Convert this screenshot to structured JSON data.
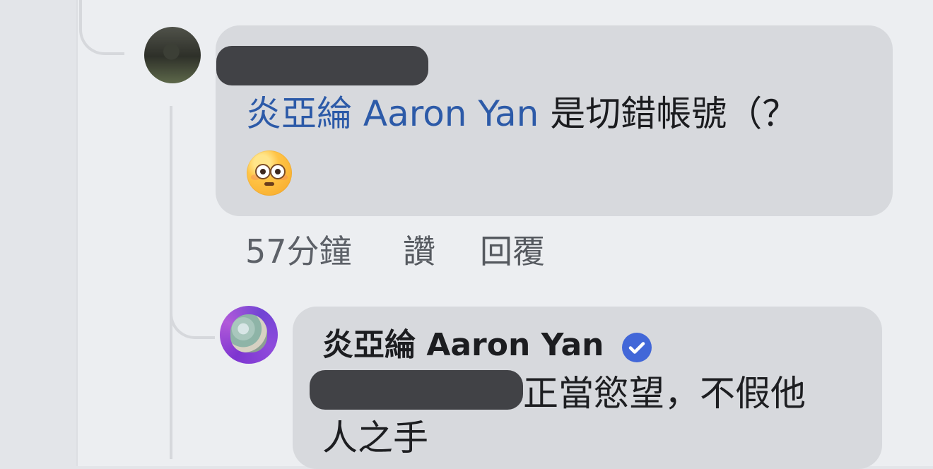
{
  "comment": {
    "mention": "炎亞綸 Aaron Yan",
    "text": "是切錯帳號（？",
    "time": "57分鐘",
    "like_label": "讚",
    "reply_label": "回覆",
    "emoji": "flushed-face"
  },
  "reply": {
    "name": "炎亞綸 Aaron Yan",
    "line1": "正當慾望，不假他",
    "line2": "人之手"
  },
  "colors": {
    "background": "#e3e5e9",
    "bubble": "#d7d9dd",
    "mention": "#2c5aa8",
    "verified": "#4267d8",
    "redaction": "#414246"
  }
}
